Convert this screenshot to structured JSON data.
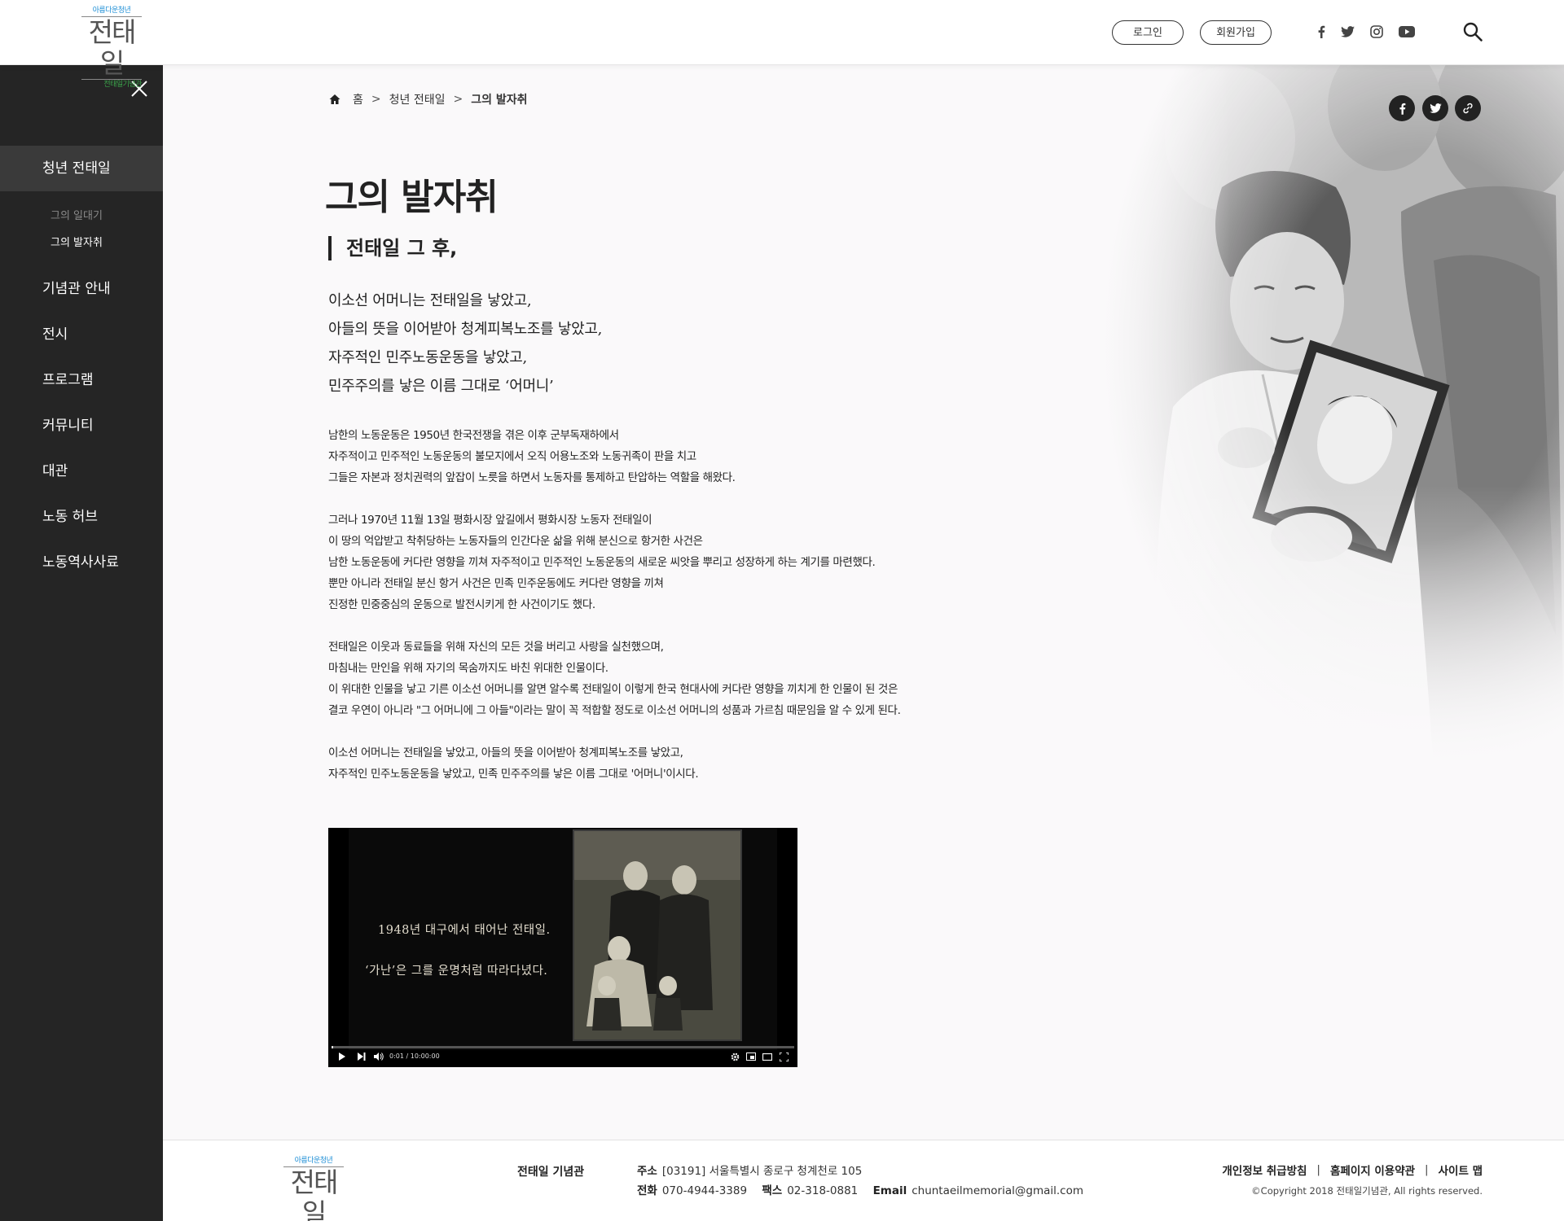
{
  "header": {
    "logo": {
      "top": "아름다운청년",
      "main": "전태일",
      "sub": "전태일기념관"
    },
    "login_label": "로그인",
    "join_label": "회원가입",
    "social": [
      "facebook-icon",
      "twitter-icon",
      "instagram-icon",
      "youtube-icon"
    ],
    "search_icon": "search-icon"
  },
  "sidebar": {
    "items": [
      {
        "label": "청년 전태일",
        "active": true
      },
      {
        "label": "기념관 안내"
      },
      {
        "label": "전시"
      },
      {
        "label": "프로그램"
      },
      {
        "label": "커뮤니티"
      },
      {
        "label": "대관"
      },
      {
        "label": "노동 허브"
      },
      {
        "label": "노동역사사료"
      }
    ],
    "subitems": [
      {
        "label": "그의 일대기",
        "active": false
      },
      {
        "label": "그의 발자취",
        "active": true
      }
    ]
  },
  "breadcrumb": {
    "home": "홈",
    "section": "청년 전태일",
    "current": "그의 발자취",
    "separator": ">"
  },
  "page": {
    "title": "그의 발자취",
    "subtitle": "전태일 그 후,",
    "poem": [
      "이소선 어머니는 전태일을 낳았고,",
      "아들의 뜻을 이어받아 청계피복노조를 낳았고,",
      "자주적인 민주노동운동을 낳았고,",
      "민주주의를 낳은 이름 그대로 ‘어머니’"
    ],
    "paragraphs": [
      [
        "남한의 노동운동은 1950년 한국전쟁을 겪은 이후 군부독재하에서",
        "자주적이고 민주적인 노동운동의 불모지에서 오직 어용노조와 노동귀족이 판을 치고",
        "그들은 자본과 정치권력의 앞잡이 노릇을 하면서 노동자를 통제하고 탄압하는 역할을 해왔다."
      ],
      [
        "그러나 1970년 11월 13일 평화시장 앞길에서 평화시장 노동자 전태일이",
        "이 땅의 억압받고 착취당하는 노동자들의 인간다운 삶을 위해 분신으로 항거한 사건은",
        "남한 노동운동에 커다란 영향을 끼쳐 자주적이고 민주적인 노동운동의 새로운 씨앗을 뿌리고 성장하게 하는 계기를 마련했다.",
        "뿐만 아니라 전태일 분신 항거 사건은 민족 민주운동에도 커다란 영향을 끼쳐",
        "진정한 민중중심의 운동으로 발전시키게 한 사건이기도 했다."
      ],
      [
        "전태일은 이웃과 동료들을 위해 자신의 모든 것을 버리고 사랑을 실천했으며,",
        "마침내는 만인을 위해 자기의 목숨까지도 바친 위대한 인물이다.",
        "이 위대한 인물을 낳고 기른 이소선 어머니를 알면 알수록 전태일이 이렇게 한국 현대사에 커다란 영향을 끼치게 한 인물이 된 것은",
        "결코 우연이 아니라 \"그 어머니에 그 아들\"이라는 말이 꼭 적합할 정도로 이소선 어머니의 성품과 가르침 때문임을 알 수 있게 된다."
      ],
      [
        "이소선 어머니는 전태일을 낳았고, 아들의 뜻을 이어받아 청계피복노조를 낳았고,",
        "자주적인 민주노동운동을 낳았고, 민족 민주주의를 낳은 이름 그대로 '어머니'이시다."
      ]
    ]
  },
  "video": {
    "caption1": "1948년 대구에서 태어난 전태일.",
    "caption2": "‘가난’은 그를 운명처럼 따라다녔다.",
    "timecode": "0:01 / 10:00:00",
    "progress": 0.002
  },
  "share": [
    "facebook-share-icon",
    "twitter-share-icon",
    "link-share-icon"
  ],
  "footer": {
    "org_name": "전태일 기념관",
    "address_label": "주소",
    "address": "[03191] 서울특별시 종로구 청계천로 105",
    "phone_label": "전화",
    "phone": "070-4944-3389",
    "fax_label": "팩스",
    "fax": "02-318-0881",
    "email_label": "Email",
    "email": "chuntaeilmemorial@gmail.com",
    "links": [
      "개인정보 취급방침",
      "홈페이지 이용약관",
      "사이트 맵"
    ],
    "link_separator": "|",
    "copyright": "©Copyright 2018 전태일기념관, All rights reserved."
  },
  "colors": {
    "sidebar_bg": "#252525",
    "sidebar_active": "#3a3a3a",
    "logo_blue": "#1f8fd6",
    "logo_green": "#3aa54a"
  }
}
